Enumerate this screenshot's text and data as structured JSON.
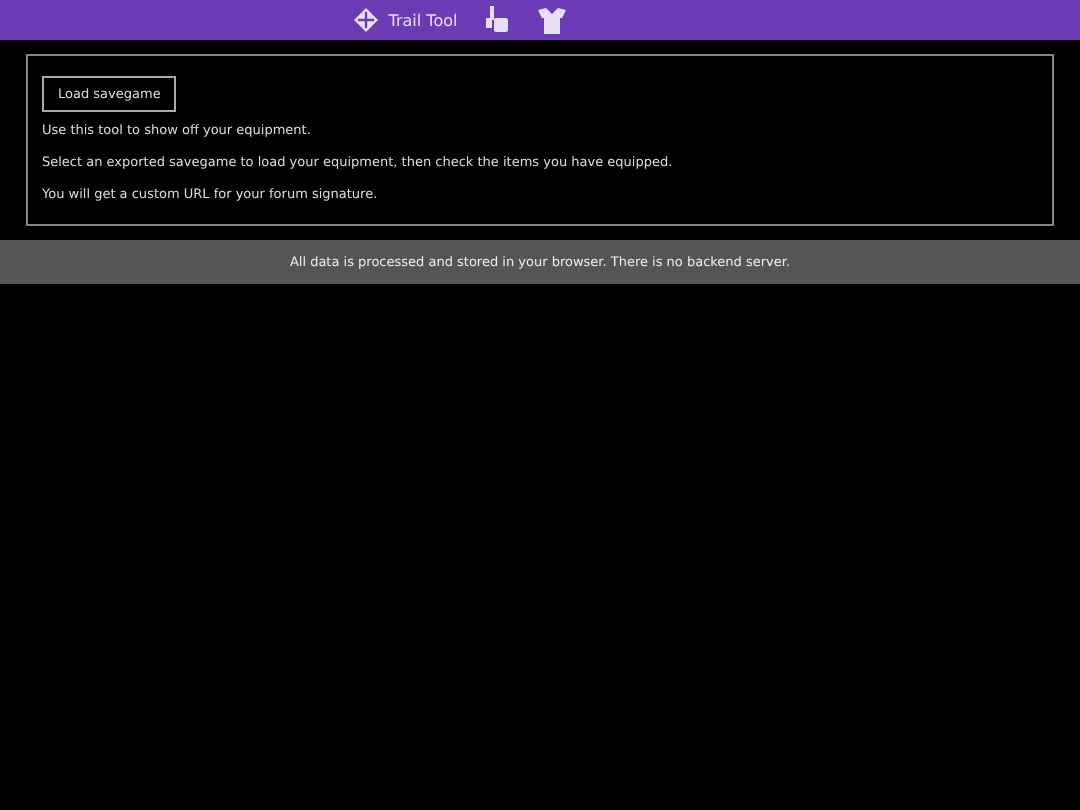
{
  "nav": {
    "brand": "Trail Tool"
  },
  "panel": {
    "button": "Load savegame",
    "paragraphs": [
      "Use this tool to show off your equipment.",
      "Select an exported savegame to load your equipment, then check the items you have equipped.",
      "You will get a custom URL for your forum signature."
    ]
  },
  "footer": "All data is processed and stored in your browser. There is no backend server."
}
